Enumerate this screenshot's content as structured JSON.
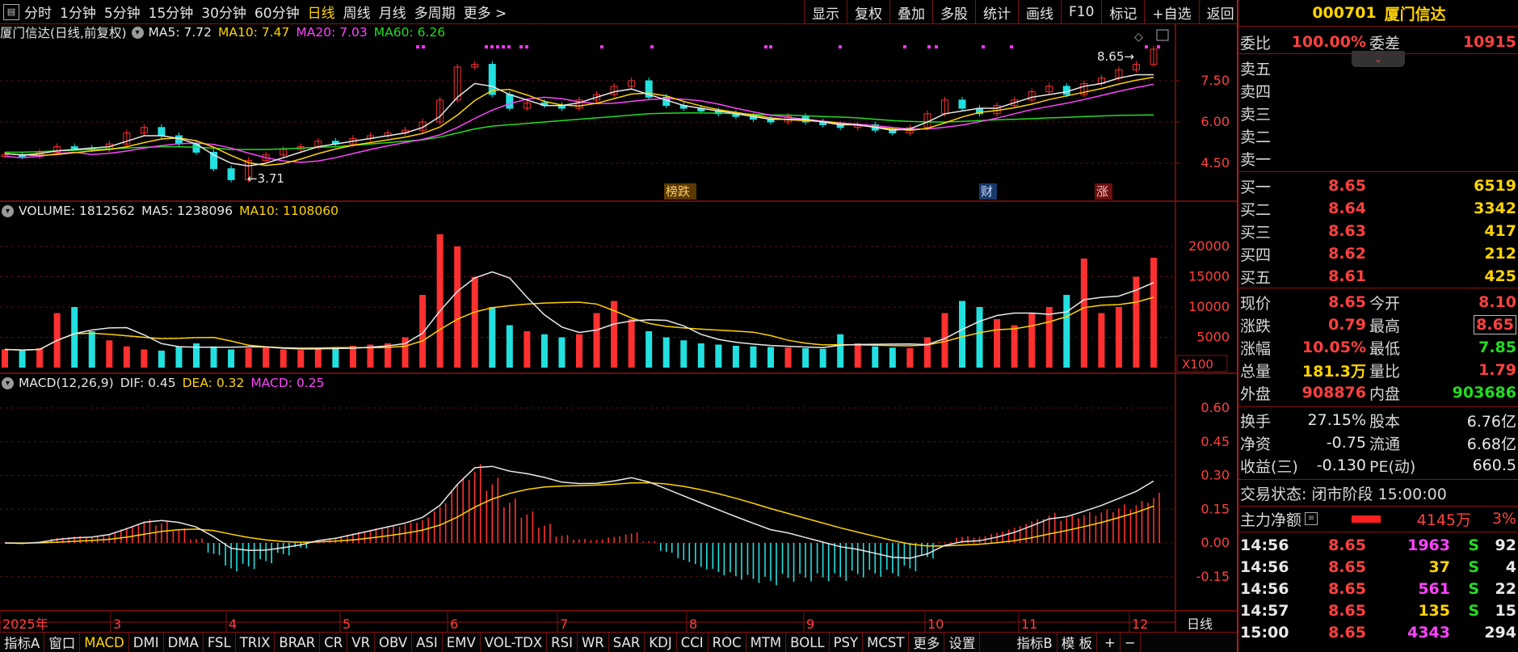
{
  "toolbar": {
    "menu_icon": "square-menu-icon",
    "periods": [
      "分时",
      "1分钟",
      "5分钟",
      "15分钟",
      "30分钟",
      "60分钟",
      "日线",
      "周线",
      "月线",
      "多周期",
      "更多 >"
    ],
    "active_period": "日线",
    "right_buttons": [
      "显示",
      "复权",
      "叠加",
      "多股",
      "统计",
      "画线",
      "F10",
      "标记",
      "+自选",
      "返回"
    ]
  },
  "legends": {
    "price": {
      "title": "厦门信达(日线,前复权)",
      "ma5": "MA5: 7.72",
      "ma10": "MA10: 7.47",
      "ma20": "MA20: 7.03",
      "ma60": "MA60: 6.26"
    },
    "volume": {
      "title": "VOLUME: 1812562",
      "ma5": "MA5: 1238096",
      "ma10": "MA10: 1108060"
    },
    "macd": {
      "title": "MACD(12,26,9)",
      "dif": "DIF: 0.45",
      "dea": "DEA: 0.32",
      "macd": "MACD: 0.25"
    }
  },
  "axes": {
    "price_ticks": [
      "7.50",
      "6.00",
      "4.50"
    ],
    "volume_ticks": [
      "20000",
      "15000",
      "10000",
      "5000"
    ],
    "volume_unit": "X100",
    "macd_ticks": [
      "0.60",
      "0.45",
      "0.30",
      "0.15",
      "0.00",
      "-0.15"
    ],
    "months": [
      "2025年",
      "3",
      "4",
      "5",
      "6",
      "7",
      "8",
      "9",
      "10",
      "11",
      "12"
    ],
    "period_label": "日线"
  },
  "annotations": {
    "low": "3.71",
    "high": "8.65",
    "tag1": "榜跌",
    "tag2": "财",
    "tag3": "涨"
  },
  "chart_data": {
    "type": "line",
    "title": "厦门信达(日线,前复权)",
    "series": [
      {
        "name": "Close",
        "values": [
          4.8,
          4.75,
          4.9,
          5.1,
          5.05,
          5.0,
          5.2,
          5.6,
          5.8,
          5.5,
          5.2,
          4.9,
          4.3,
          3.9,
          4.6,
          4.8,
          5.0,
          5.1,
          5.3,
          5.2,
          5.4,
          5.5,
          5.6,
          5.7,
          6.0,
          6.8,
          8.0,
          8.1,
          7.0,
          6.5,
          6.7,
          6.6,
          6.5,
          6.8,
          7.0,
          7.3,
          7.5,
          6.9,
          6.6,
          6.5,
          6.4,
          6.3,
          6.2,
          6.1,
          6.0,
          6.2,
          6.0,
          5.9,
          5.8,
          5.9,
          5.7,
          5.6,
          5.8,
          6.3,
          6.8,
          6.5,
          6.3,
          6.6,
          6.8,
          7.1,
          7.3,
          7.0,
          7.4,
          7.6,
          7.9,
          8.1,
          8.65
        ]
      },
      {
        "name": "MA5",
        "values": [
          4.85,
          4.8,
          4.85,
          4.95,
          5.0,
          5.05,
          5.1,
          5.3,
          5.5,
          5.5,
          5.4,
          5.2,
          4.8,
          4.5,
          4.4,
          4.5,
          4.7,
          4.9,
          5.1,
          5.2,
          5.3,
          5.4,
          5.5,
          5.6,
          5.8,
          6.2,
          6.9,
          7.4,
          7.3,
          7.0,
          6.8,
          6.6,
          6.6,
          6.7,
          6.9,
          7.1,
          7.2,
          7.0,
          6.8,
          6.6,
          6.5,
          6.4,
          6.3,
          6.2,
          6.1,
          6.1,
          6.1,
          6.0,
          5.9,
          5.9,
          5.8,
          5.7,
          5.75,
          6.0,
          6.3,
          6.4,
          6.5,
          6.5,
          6.7,
          6.9,
          7.0,
          7.1,
          7.3,
          7.4,
          7.6,
          7.72,
          7.72
        ]
      },
      {
        "name": "MA60",
        "values": [
          4.9,
          4.9,
          4.92,
          4.95,
          4.97,
          5.0,
          5.02,
          5.05,
          5.08,
          5.1,
          5.1,
          5.08,
          5.05,
          5.0,
          5.0,
          5.0,
          5.02,
          5.05,
          5.08,
          5.1,
          5.15,
          5.2,
          5.25,
          5.3,
          5.35,
          5.45,
          5.6,
          5.75,
          5.85,
          5.9,
          5.95,
          6.0,
          6.05,
          6.1,
          6.15,
          6.2,
          6.25,
          6.3,
          6.32,
          6.33,
          6.33,
          6.32,
          6.3,
          6.28,
          6.26,
          6.25,
          6.23,
          6.2,
          6.18,
          6.15,
          6.1,
          6.05,
          6.02,
          6.0,
          6.0,
          6.02,
          6.05,
          6.08,
          6.1,
          6.12,
          6.15,
          6.17,
          6.2,
          6.22,
          6.24,
          6.25,
          6.26
        ]
      }
    ],
    "volume": [
      3000,
      2800,
      3200,
      9000,
      10000,
      6000,
      4500,
      3500,
      3000,
      2800,
      3500,
      4000,
      3500,
      3000,
      3200,
      3300,
      3000,
      2900,
      3100,
      3400,
      3600,
      3800,
      4000,
      5000,
      12000,
      22000,
      20000,
      15000,
      10000,
      7000,
      6000,
      5500,
      5000,
      5500,
      9000,
      11000,
      8000,
      6000,
      5000,
      4500,
      4000,
      3800,
      3600,
      3500,
      3400,
      3300,
      3200,
      3100,
      5500,
      4000,
      3500,
      3300,
      3200,
      5000,
      9000,
      11000,
      10000,
      8000,
      7000,
      9000,
      10000,
      12000,
      18000,
      9000,
      10000,
      15000,
      18125
    ],
    "ylim": [
      3.5,
      9.0
    ],
    "xlabel": "",
    "ylabel": ""
  },
  "panel": {
    "code": "000701",
    "name": "厦门信达",
    "weibi_label": "委比",
    "weibi_value": "100.00%",
    "weicha_label": "委差",
    "weicha_value": "10915",
    "sell": [
      {
        "label": "卖五",
        "price": "",
        "vol": ""
      },
      {
        "label": "卖四",
        "price": "",
        "vol": ""
      },
      {
        "label": "卖三",
        "price": "",
        "vol": ""
      },
      {
        "label": "卖二",
        "price": "",
        "vol": ""
      },
      {
        "label": "卖一",
        "price": "",
        "vol": ""
      }
    ],
    "buy": [
      {
        "label": "买一",
        "price": "8.65",
        "vol": "6519"
      },
      {
        "label": "买二",
        "price": "8.64",
        "vol": "3342"
      },
      {
        "label": "买三",
        "price": "8.63",
        "vol": "417"
      },
      {
        "label": "买四",
        "price": "8.62",
        "vol": "212"
      },
      {
        "label": "买五",
        "price": "8.61",
        "vol": "425"
      }
    ],
    "quote": [
      {
        "l1": "现价",
        "v1": "8.65",
        "c1": "red",
        "l2": "今开",
        "v2": "8.10",
        "c2": "red"
      },
      {
        "l1": "涨跌",
        "v1": "0.79",
        "c1": "red",
        "l2": "最高",
        "v2": "8.65",
        "c2": "red"
      },
      {
        "l1": "涨幅",
        "v1": "10.05%",
        "c1": "red",
        "l2": "最低",
        "v2": "7.85",
        "c2": "green"
      },
      {
        "l1": "总量",
        "v1": "181.3万",
        "c1": "yellow",
        "l2": "量比",
        "v2": "1.79",
        "c2": "red"
      },
      {
        "l1": "外盘",
        "v1": "908876",
        "c1": "red",
        "l2": "内盘",
        "v2": "903686",
        "c2": "green"
      }
    ],
    "stats": [
      {
        "l1": "换手",
        "v1": "27.15%",
        "l2": "股本",
        "v2": "6.76亿"
      },
      {
        "l1": "净资",
        "v1": "-0.75",
        "l2": "流通",
        "v2": "6.68亿"
      },
      {
        "l1": "收益(三)",
        "v1": "-0.130",
        "l2": "PE(动)",
        "v2": "660.5"
      }
    ],
    "trade_status": "交易状态: 闭市阶段 15:00:00",
    "main_force_label": "主力净额",
    "main_force_value": "4145万",
    "main_force_pct": "3%",
    "ticks": [
      {
        "time": "14:56",
        "price": "8.65",
        "vol": "1963",
        "side": "S",
        "n": "92",
        "vc": "magenta"
      },
      {
        "time": "14:56",
        "price": "8.65",
        "vol": "37",
        "side": "S",
        "n": "4",
        "vc": "yellow"
      },
      {
        "time": "14:56",
        "price": "8.65",
        "vol": "561",
        "side": "S",
        "n": "22",
        "vc": "magenta"
      },
      {
        "time": "14:57",
        "price": "8.65",
        "vol": "135",
        "side": "S",
        "n": "15",
        "vc": "yellow"
      },
      {
        "time": "15:00",
        "price": "8.65",
        "vol": "4343",
        "side": "",
        "n": "294",
        "vc": "magenta"
      }
    ]
  },
  "bottom_tabs": [
    "指标A",
    "窗口",
    "MACD",
    "DMI",
    "DMA",
    "FSL",
    "TRIX",
    "BRAR",
    "CR",
    "VR",
    "OBV",
    "ASI",
    "EMV",
    "VOL-TDX",
    "RSI",
    "WR",
    "SAR",
    "KDJ",
    "CCI",
    "ROC",
    "MTM",
    "BOLL",
    "PSY",
    "MCST",
    "更多",
    "设置",
    "指标B",
    "模 板",
    "+",
    "−"
  ],
  "bottom_active": "MACD"
}
